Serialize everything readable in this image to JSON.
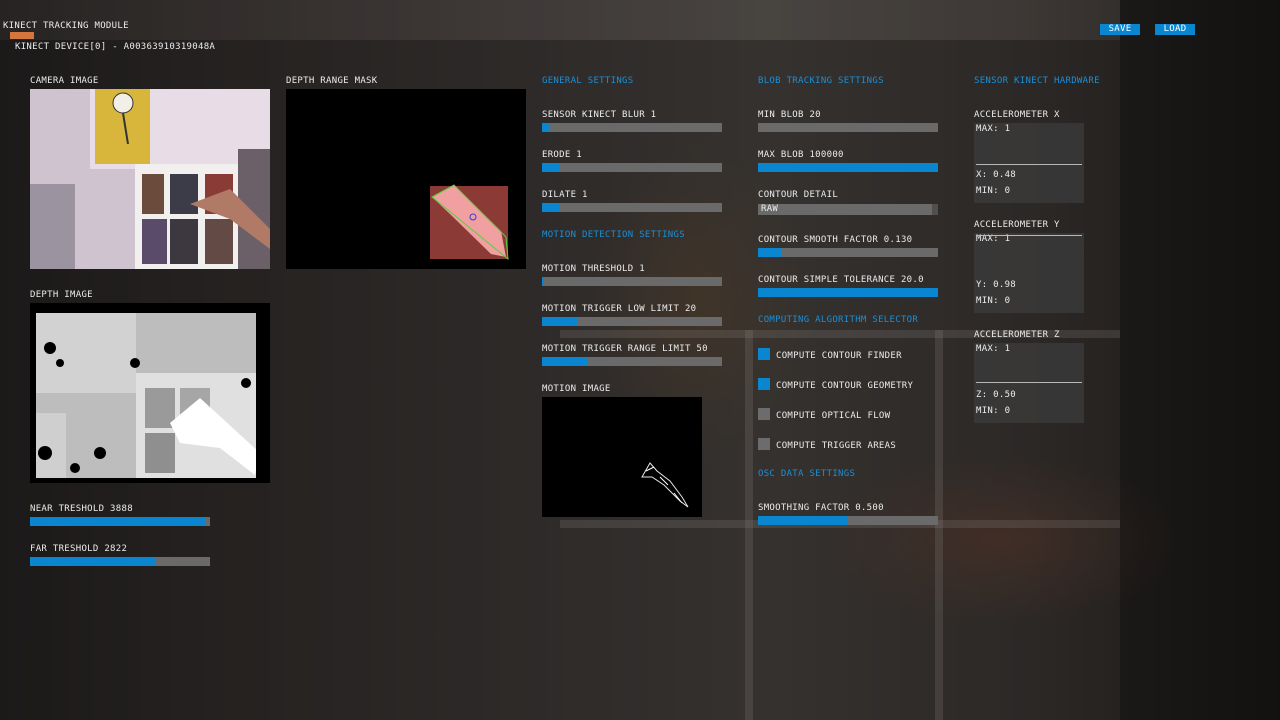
{
  "app": {
    "title": "KINECT TRACKING MODULE",
    "device": "KINECT DEVICE[0] - A00363910319048A",
    "save_label": "SAVE",
    "load_label": "LOAD",
    "accent_color": "#0a86d1",
    "header_color": "#1b8fd6"
  },
  "left": {
    "camera_label": "CAMERA IMAGE",
    "depth_label": "DEPTH IMAGE",
    "near": {
      "label": "NEAR TRESHOLD 3888",
      "fill": 0.98
    },
    "far": {
      "label": "FAR TRESHOLD 2822",
      "fill": 0.7
    }
  },
  "mask": {
    "label": "DEPTH RANGE MASK"
  },
  "general": {
    "header": "GENERAL SETTINGS",
    "blur": {
      "label": "SENSOR KINECT BLUR 1",
      "fill": 0.04
    },
    "erode": {
      "label": "ERODE 1",
      "fill": 0.1
    },
    "dilate": {
      "label": "DILATE 1",
      "fill": 0.1
    }
  },
  "motion": {
    "header": "MOTION DETECTION SETTINGS",
    "threshold": {
      "label": "MOTION THRESHOLD 1",
      "fill": 0.01
    },
    "low": {
      "label": "MOTION TRIGGER LOW LIMIT 20",
      "fill": 0.2
    },
    "range": {
      "label": "MOTION TRIGGER RANGE LIMIT 50",
      "fill": 0.25
    },
    "image_label": "MOTION IMAGE"
  },
  "blob": {
    "header": "BLOB TRACKING SETTINGS",
    "min": {
      "label": "MIN BLOB 20",
      "fill": 0.0
    },
    "max": {
      "label": "MAX BLOB 100000",
      "fill": 1.0
    },
    "contour_detail_label": "CONTOUR DETAIL",
    "contour_detail_value": "RAW",
    "smooth": {
      "label": "CONTOUR SMOOTH FACTOR 0.130",
      "fill": 0.13
    },
    "simple": {
      "label": "CONTOUR SIMPLE TOLERANCE 20.0",
      "fill": 1.0
    }
  },
  "algo": {
    "header": "COMPUTING ALGORITHM SELECTOR",
    "items": [
      {
        "label": "COMPUTE CONTOUR FINDER",
        "checked": true
      },
      {
        "label": "COMPUTE CONTOUR GEOMETRY",
        "checked": true
      },
      {
        "label": "COMPUTE OPTICAL FLOW",
        "checked": false
      },
      {
        "label": "COMPUTE TRIGGER AREAS",
        "checked": false
      }
    ]
  },
  "osc": {
    "header": "OSC DATA SETTINGS",
    "smoothing": {
      "label": "SMOOTHING FACTOR 0.500",
      "fill": 0.5
    }
  },
  "sensor": {
    "header": "SENSOR KINECT HARDWARE",
    "x": {
      "label": "ACCELEROMETER X",
      "max": "MAX: 1",
      "value": "X: 0.48",
      "min": "MIN: 0",
      "level": 0.48
    },
    "y": {
      "label": "ACCELEROMETER Y",
      "max": "MAX: 1",
      "value": "Y: 0.98",
      "min": "MIN: 0",
      "level": 0.98
    },
    "z": {
      "label": "ACCELEROMETER Z",
      "max": "MAX: 1",
      "value": "Z: 0.50",
      "min": "MIN: 0",
      "level": 0.5
    }
  }
}
